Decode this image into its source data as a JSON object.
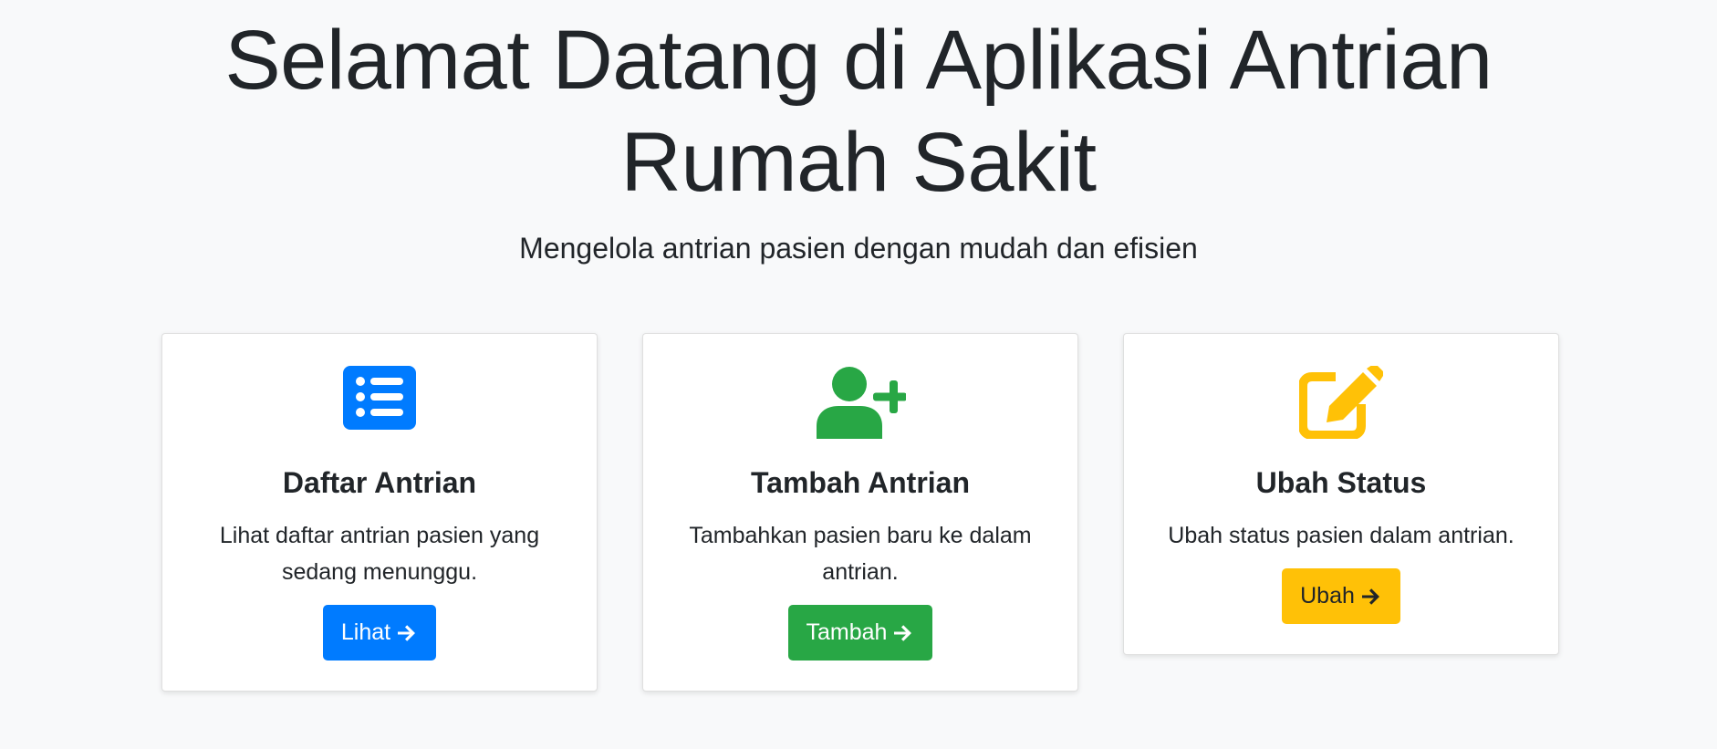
{
  "hero": {
    "title_line1": "Selamat Datang di Aplikasi Antrian",
    "title_line2": "Rumah Sakit",
    "subtitle": "Mengelola antrian pasien dengan mudah dan efisien"
  },
  "colors": {
    "background": "#f8f9fa",
    "primary": "#007bff",
    "success": "#28a745",
    "warning": "#ffc107",
    "text": "#212529"
  },
  "cards": [
    {
      "icon": "list-icon",
      "title": "Daftar Antrian",
      "text": "Lihat daftar antrian pasien yang sedang menunggu.",
      "button_label": "Lihat",
      "button_icon": "arrow-right-icon"
    },
    {
      "icon": "user-plus-icon",
      "title": "Tambah Antrian",
      "text": "Tambahkan pasien baru ke dalam antrian.",
      "button_label": "Tambah",
      "button_icon": "arrow-right-icon"
    },
    {
      "icon": "edit-icon",
      "title": "Ubah Status",
      "text": "Ubah status pasien dalam antrian.",
      "button_label": "Ubah",
      "button_icon": "arrow-right-icon"
    }
  ]
}
